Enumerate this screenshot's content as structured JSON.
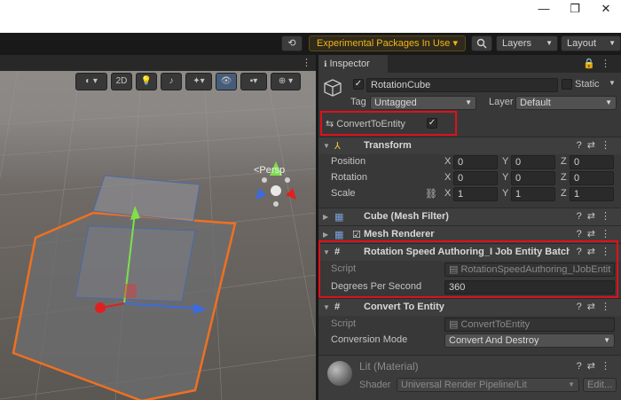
{
  "window": {
    "minimize_glyph": "—",
    "maximize_glyph": "❐",
    "close_glyph": "✕"
  },
  "toolbar": {
    "history_icon": "history-icon",
    "experimental_label": "Experimental Packages In Use ▾",
    "search_icon": "search-icon",
    "layers_label": "Layers",
    "layout_label": "Layout"
  },
  "scene": {
    "tool_2d": "2D",
    "persp_label": "<Persp",
    "menu_dots": "⋮"
  },
  "inspector": {
    "tab_label": "Inspector",
    "object_name": "RotationCube",
    "static_label": "Static",
    "tag_label": "Tag",
    "tag_value": "Untagged",
    "layer_label": "Layer",
    "layer_value": "Default",
    "convert_to_entity_label": "ConvertToEntity",
    "convert_to_entity_checked": true,
    "transform": {
      "title": "Transform",
      "rows": [
        {
          "label": "Position",
          "x": "0",
          "y": "0",
          "z": "0"
        },
        {
          "label": "Rotation",
          "x": "0",
          "y": "0",
          "z": "0"
        },
        {
          "label": "Scale",
          "x": "1",
          "y": "1",
          "z": "1"
        }
      ],
      "axis_x": "X",
      "axis_y": "Y",
      "axis_z": "Z"
    },
    "mesh_filter_title": "Cube (Mesh Filter)",
    "mesh_renderer_title": "Mesh Renderer",
    "rotation_speed": {
      "title": "Rotation Speed Authoring_I Job Entity Batch (S",
      "script_label": "Script",
      "script_value": "RotationSpeedAuthoring_IJobEntit",
      "degrees_label": "Degrees Per Second",
      "degrees_value": "360"
    },
    "convert_to_entity": {
      "title": "Convert To Entity",
      "script_label": "Script",
      "script_value": "ConvertToEntity",
      "mode_label": "Conversion Mode",
      "mode_value": "Convert And Destroy"
    },
    "material": {
      "title": "Lit (Material)",
      "shader_label": "Shader",
      "shader_value": "Universal Render Pipeline/Lit",
      "edit_label": "Edit..."
    }
  },
  "colors": {
    "highlight": "#e0101a",
    "experimental": "#f2b418",
    "selection_outline": "#f07020"
  }
}
